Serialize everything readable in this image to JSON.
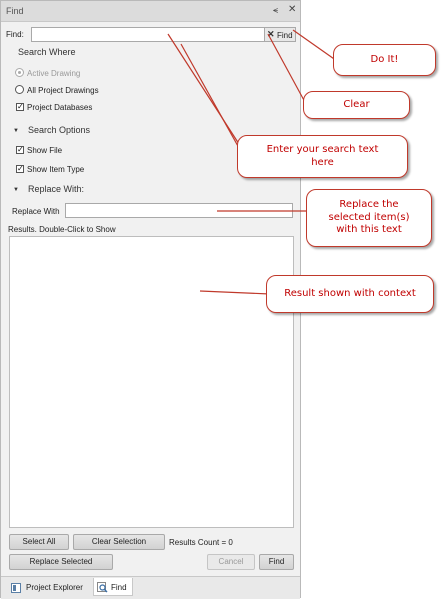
{
  "panel": {
    "title": "Find",
    "pin_glyph": "⪪",
    "close_glyph": "✕",
    "find_label": "Find:",
    "find_value": "",
    "clear_glyph": "✕",
    "find_go_label": "Find",
    "search_where": "Search Where",
    "options": {
      "active_drawing": "Active Drawing",
      "all_project_drawings": "All Project Drawings",
      "project_databases": "Project Databases"
    },
    "search_options": "Search Options",
    "show_file": "Show File",
    "show_item_type": "Show Item Type",
    "replace_with_header": "Replace With:",
    "replace_with_label": "Replace With",
    "replace_value": "",
    "results_label": "Results. Double-Click to Show",
    "buttons": {
      "select_all": "Select All",
      "clear_selection": "Clear Selection",
      "results_count": "Results Count = 0",
      "replace_selected": "Replace Selected",
      "cancel": "Cancel",
      "find": "Find"
    },
    "tabs": {
      "project_explorer": "Project Explorer",
      "find": "Find"
    }
  },
  "callouts": {
    "do_it": "Do It!",
    "clear": "Clear",
    "enter_search": "Enter your search text here",
    "replace": "Replace the selected item(s) with this text",
    "result": "Result shown with context"
  },
  "colors": {
    "callout_border": "#c0392b",
    "callout_text": "#c00000",
    "arrow": "#c0392b"
  }
}
